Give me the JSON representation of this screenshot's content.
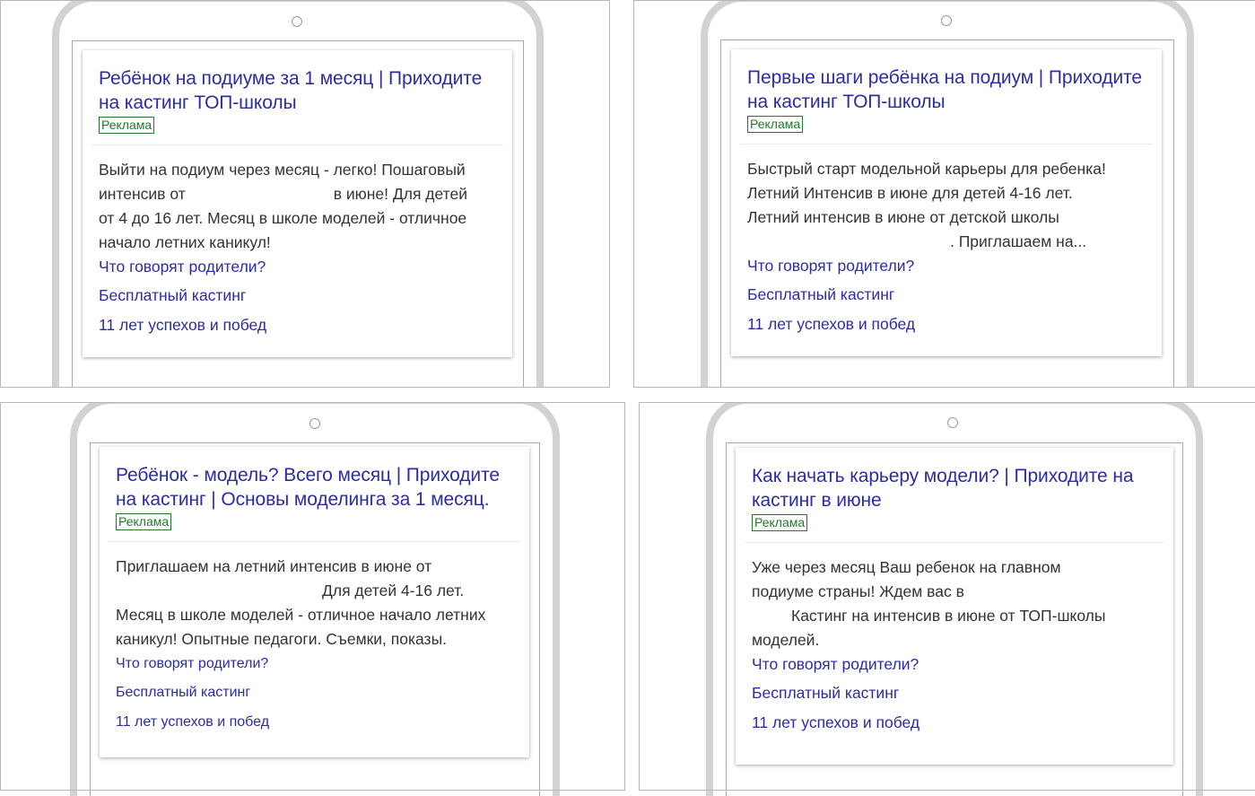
{
  "ads": [
    {
      "title": "Ребёнок на подиуме за 1 месяц | Приходите на кастинг ТОП-школы",
      "badge": "Реклама",
      "desc_lines": [
        "Выйти на подиум через месяц - легко! Пошаговый",
        "интенсив от",
        "в июне! Для детей",
        "от 4 до 16 лет. Месяц в школе моделей - отличное",
        "начало летних каникул!"
      ],
      "links": [
        "Что говорят родители?",
        "Бесплатный кастинг",
        "11 лет успехов и побед"
      ]
    },
    {
      "title": "Первые шаги ребёнка на подиум | Приходите на кастинг ТОП-школы",
      "badge": "Реклама",
      "desc_lines": [
        "Быстрый старт модельной карьеры для ребенка!",
        "Летний Интенсив в июне для детей 4-16 лет.",
        "Летний интенсив в июне от детской школы",
        ". Приглашаем на..."
      ],
      "links": [
        "Что говорят родители?",
        "Бесплатный кастинг",
        "11 лет успехов и побед"
      ]
    },
    {
      "title": "Ребёнок - модель? Всего месяц | Приходите на кастинг | Основы моделинга за 1 месяц.",
      "badge": "Реклама",
      "desc_lines": [
        "Приглашаем на летний интенсив в июне от",
        "Для детей 4-16 лет.",
        "Месяц в школе моделей - отличное начало летних",
        "каникул! Опытные педагоги. Съемки, показы."
      ],
      "links": [
        "Что говорят родители?",
        "Бесплатный кастинг",
        "11 лет успехов и побед"
      ]
    },
    {
      "title": "Как начать карьеру модели? | Приходите на кастинг в июне",
      "badge": "Реклама",
      "desc_lines": [
        "Уже через месяц Ваш ребенок на главном",
        "подиуме страны! Ждем вас в",
        "Кастинг на интенсив в июне от ТОП-школы",
        "моделей."
      ],
      "links": [
        "Что говорят родители?",
        "Бесплатный кастинг",
        "11 лет успехов и побед"
      ]
    }
  ]
}
